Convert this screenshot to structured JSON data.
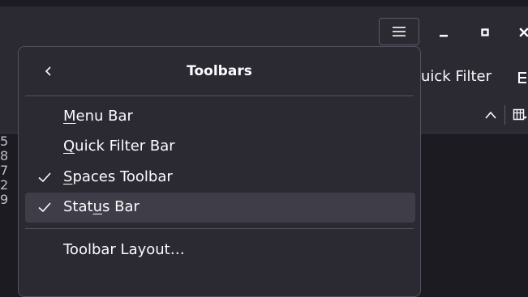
{
  "toolbar": {
    "quick_filter_label": "uick Filter"
  },
  "left_numbers": [
    "5",
    "8",
    "7",
    "2",
    "9"
  ],
  "panel": {
    "title": "Toolbars",
    "items": [
      {
        "label_pre": "",
        "accel": "M",
        "label_post": "enu Bar",
        "checked": false
      },
      {
        "label_pre": "",
        "accel": "Q",
        "label_post": "uick Filter Bar",
        "checked": false
      },
      {
        "label_pre": "",
        "accel": "S",
        "label_post": "paces Toolbar",
        "checked": true
      },
      {
        "label_pre": "Stat",
        "accel": "u",
        "label_post": "s Bar",
        "checked": true
      }
    ],
    "layout_item": {
      "label": "Toolbar Layout…"
    }
  },
  "icons": {
    "menu": "hamburger-icon",
    "minimize": "minimize-icon",
    "maximize": "maximize-icon",
    "close": "close-icon",
    "back": "chevron-left-icon",
    "check": "checkmark-icon",
    "sort": "chevron-up-icon",
    "columns": "column-picker-icon",
    "quick_filter": "quick-filter-icon"
  },
  "colors": {
    "panel_bg": "#2b2a33",
    "hover_bg": "#3f3e48",
    "text": "#fbfbfe",
    "border": "#52525e"
  }
}
